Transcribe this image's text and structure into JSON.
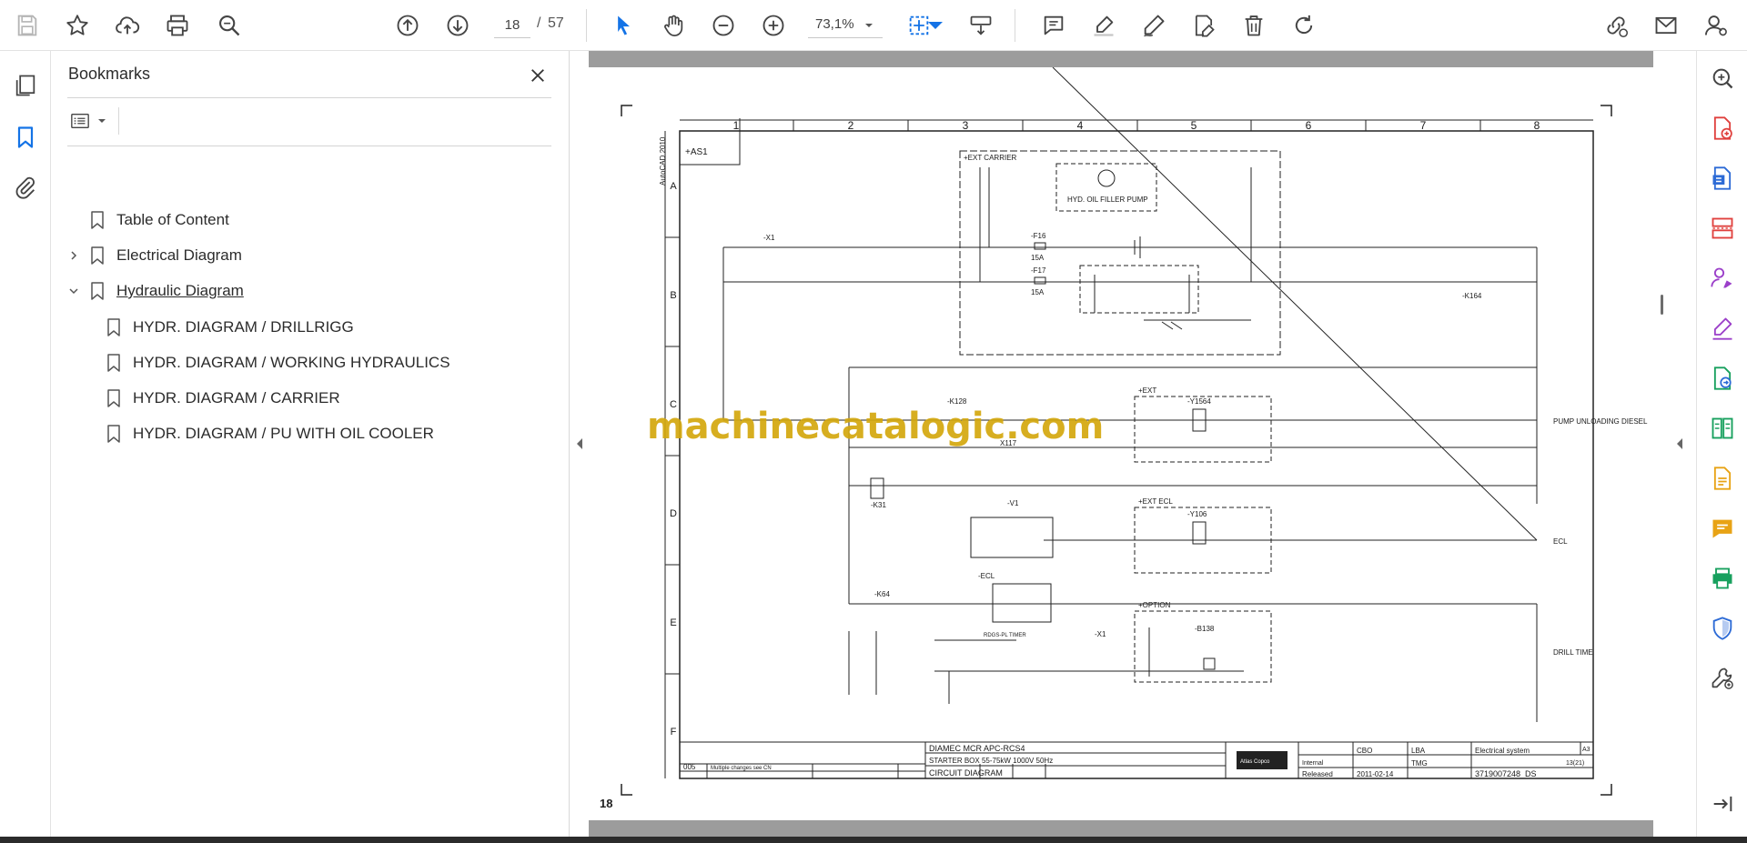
{
  "toolbar": {
    "page_current": "18",
    "page_separator": "/",
    "page_total": "57",
    "zoom": "73,1%"
  },
  "bookmarks": {
    "title": "Bookmarks",
    "items": [
      {
        "label": "Table of Content"
      },
      {
        "label": "Electrical Diagram"
      },
      {
        "label": "Hydraulic Diagram"
      },
      {
        "label": "HYDR. DIAGRAM / DRILLRIGG"
      },
      {
        "label": "HYDR. DIAGRAM / WORKING HYDRAULICS"
      },
      {
        "label": "HYDR. DIAGRAM / CARRIER"
      },
      {
        "label": "HYDR. DIAGRAM / PU WITH OIL COOLER"
      }
    ]
  },
  "document": {
    "watermark": "machinecatalogic.com",
    "page_label": "18",
    "drawing": {
      "col_numbers": [
        "1",
        "2",
        "3",
        "4",
        "5",
        "6",
        "7",
        "8"
      ],
      "row_letters": [
        "A",
        "B",
        "C",
        "D",
        "E",
        "F"
      ],
      "side_note": "AutoCAD 2010",
      "ref_block": "+AS1",
      "carrier_box": "+EXT CARRIER",
      "pump_label": "HYD. OIL FILLER PUMP",
      "fuse_1": "-F16",
      "fuse_1_rating": "15A",
      "fuse_2": "-F17",
      "fuse_2_rating": "15A",
      "relay_k164": "-K164",
      "relay_k128": "-K128",
      "relay_k31": "-K31",
      "relay_k64": "-K64",
      "valve_y1564": "-Y1564",
      "valve_y106": "-Y106",
      "valve_b138": "-B138",
      "ext_1": "+EXT",
      "ext_2": "+EXT ECL",
      "option": "+OPTION",
      "v1": "-V1",
      "ecl": "-ECL",
      "timer": "RDGS-PL TIMER",
      "x1_top": "-X1",
      "x1_bottom": "-X1",
      "x117": "X117",
      "label_pump_unloading": "PUMP UNLOADING DIESEL",
      "label_ecl": "ECL",
      "label_drill_time": "DRILL TIME",
      "tb_company": "DIAMEC  MCR APC-RCS4",
      "tb_desc": "STARTER BOX 55-75kW 1000V 50Hz",
      "tb_type": "CIRCUIT DIAGRAM",
      "tb_status": "Released",
      "tb_date": "2011-02-14",
      "tb_system": "Electrical system",
      "tb_drawing_no": "3719007248_DS",
      "tb_sheet": "13(21)",
      "tb_size": "A3",
      "tb_rev": "005",
      "tb_change": "Multiple changes see CN",
      "tb_drawn": "CBO",
      "tb_approved": "LBA",
      "tb_owner": "TMG",
      "tb_confidentiality": "Internal",
      "tb_brand": "Atlas Copco"
    }
  },
  "colors": {
    "accent": "#1473e6",
    "watermark": "#d4a80e"
  }
}
